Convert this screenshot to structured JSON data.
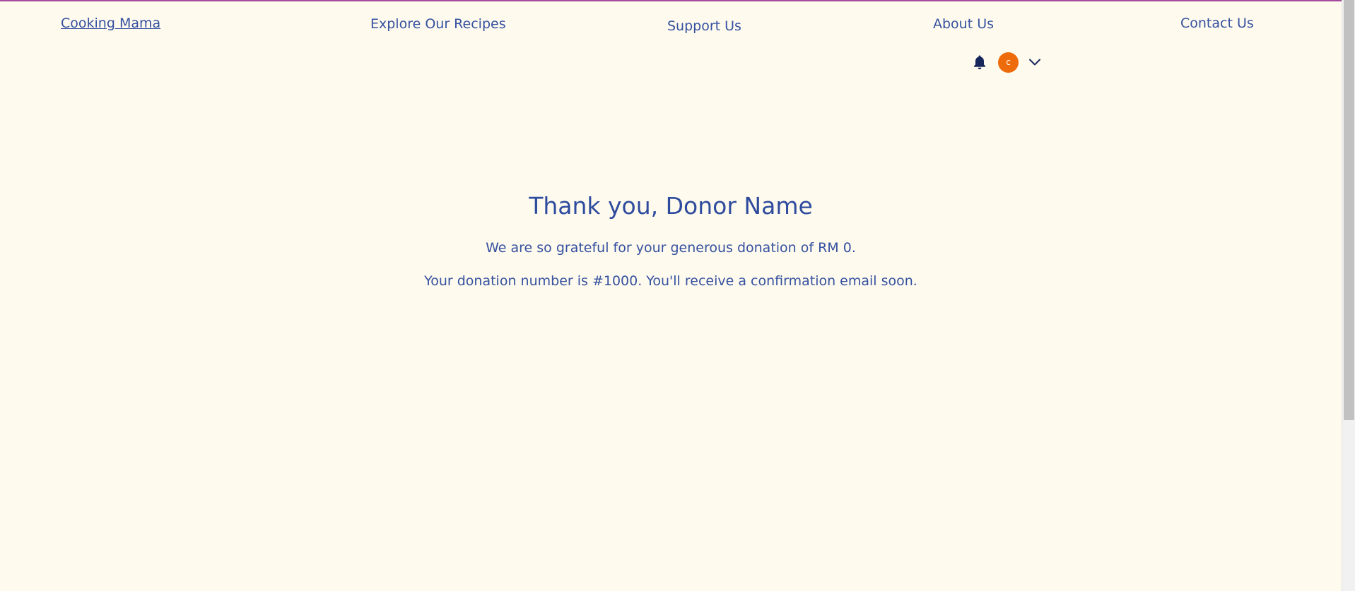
{
  "nav": {
    "brand": "Cooking Mama",
    "links": [
      "Explore Our Recipes",
      "Support Us",
      "About Us",
      "Contact Us"
    ]
  },
  "user": {
    "avatar_initial": "c",
    "avatar_color": "#ee6b0b",
    "bell_icon": "bell-icon",
    "menu_icon": "chevron-down-icon"
  },
  "thankyou": {
    "heading": "Thank you, Donor Name",
    "message": "We are so grateful for your generous donation of RM 0.",
    "confirmation": "Your donation number is #1000. You'll receive a confirmation email soon."
  },
  "colors": {
    "background": "#fefaee",
    "text": "#2e4b9e",
    "top_border": "#a44a9e"
  }
}
